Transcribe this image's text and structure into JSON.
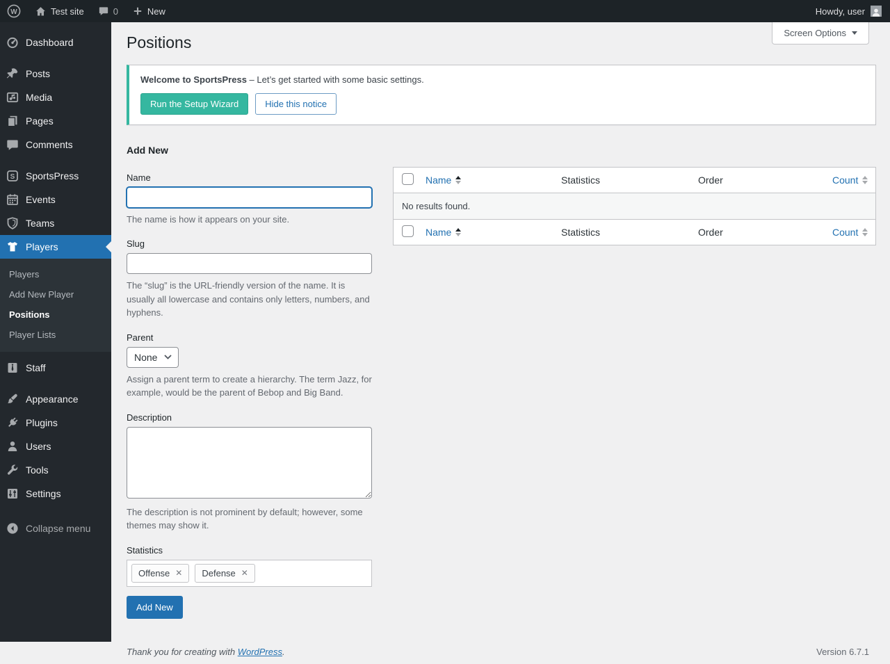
{
  "admin_bar": {
    "site_name": "Test site",
    "comments_count": "0",
    "new_label": "New",
    "howdy": "Howdy, user"
  },
  "icons": {
    "wp_logo_letter": "W",
    "sportspress_letter": "S",
    "remove_tag": "✕"
  },
  "sidebar": {
    "items": [
      {
        "label": "Dashboard",
        "icon": "dashboard-icon"
      },
      {
        "label": "Posts",
        "icon": "pin-icon"
      },
      {
        "label": "Media",
        "icon": "media-icon"
      },
      {
        "label": "Pages",
        "icon": "pages-icon"
      },
      {
        "label": "Comments",
        "icon": "comment-icon"
      },
      {
        "label": "SportsPress",
        "icon": "sportspress-icon"
      },
      {
        "label": "Events",
        "icon": "calendar-icon"
      },
      {
        "label": "Teams",
        "icon": "shield-icon"
      },
      {
        "label": "Players",
        "icon": "jersey-icon",
        "active": true
      },
      {
        "label": "Staff",
        "icon": "tie-icon"
      },
      {
        "label": "Appearance",
        "icon": "brush-icon"
      },
      {
        "label": "Plugins",
        "icon": "plugin-icon"
      },
      {
        "label": "Users",
        "icon": "user-icon"
      },
      {
        "label": "Tools",
        "icon": "wrench-icon"
      },
      {
        "label": "Settings",
        "icon": "sliders-icon"
      },
      {
        "label": "Collapse menu",
        "icon": "collapse-icon"
      }
    ],
    "players_submenu": [
      {
        "label": "Players"
      },
      {
        "label": "Add New Player"
      },
      {
        "label": "Positions",
        "current": true
      },
      {
        "label": "Player Lists"
      }
    ]
  },
  "page": {
    "title": "Positions",
    "screen_options_label": "Screen Options"
  },
  "notice": {
    "title": "Welcome to SportsPress",
    "text": " – Let’s get started with some basic settings.",
    "run_wizard_label": "Run the Setup Wizard",
    "hide_label": "Hide this notice"
  },
  "form": {
    "heading": "Add New",
    "name_label": "Name",
    "name_value": "",
    "name_help": "The name is how it appears on your site.",
    "slug_label": "Slug",
    "slug_value": "",
    "slug_help": "The “slug” is the URL-friendly version of the name. It is usually all lowercase and contains only letters, numbers, and hyphens.",
    "parent_label": "Parent",
    "parent_value": "None",
    "parent_help": "Assign a parent term to create a hierarchy. The term Jazz, for example, would be the parent of Bebop and Big Band.",
    "description_label": "Description",
    "description_value": "",
    "description_help": "The description is not prominent by default; however, some themes may show it.",
    "statistics_label": "Statistics",
    "statistics_tags": [
      "Offense",
      "Defense"
    ],
    "submit_label": "Add New"
  },
  "table": {
    "columns": [
      "Name",
      "Statistics",
      "Order",
      "Count"
    ],
    "empty_message": "No results found."
  },
  "footer": {
    "thanks_prefix": "Thank you for creating with ",
    "wordpress_link": "WordPress",
    "thanks_suffix": ".",
    "version": "Version 6.7.1"
  },
  "colors": {
    "accent_blue": "#2271b1",
    "sportspress_teal": "#35b7a0",
    "admin_bar_bg": "#1d2327",
    "menu_bg": "#23282d",
    "submenu_bg": "#2c3338",
    "page_bg": "#f0f0f1"
  }
}
